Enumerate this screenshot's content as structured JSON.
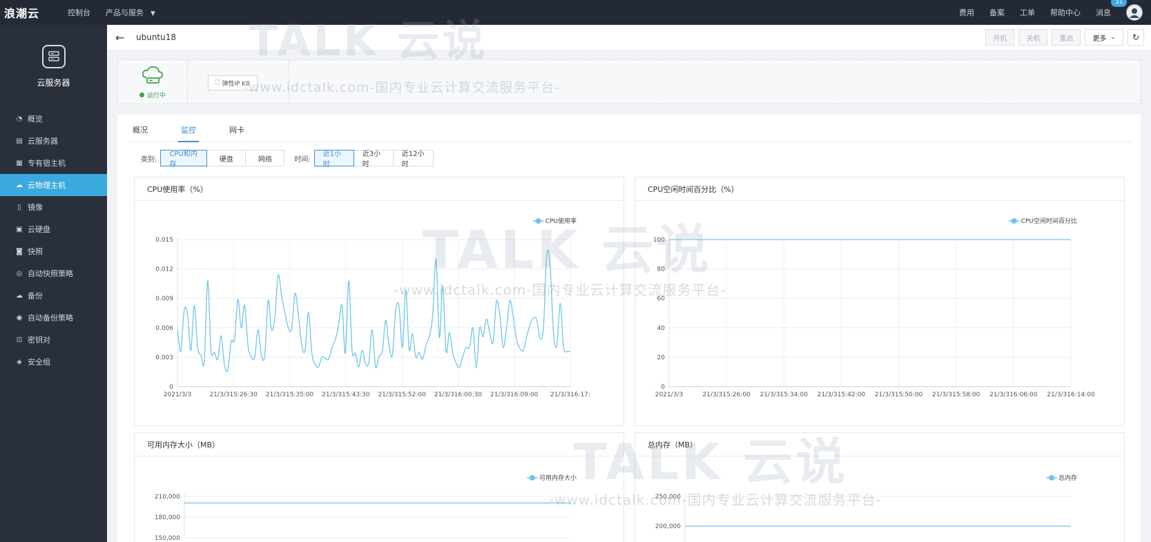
{
  "topbar": {
    "logo": "浪潮云",
    "nav": [
      "控制台",
      "产品与服务"
    ],
    "right": [
      "费用",
      "备案",
      "工单",
      "帮助中心",
      "消息"
    ],
    "message_count": "31"
  },
  "sidebar": {
    "title": "云服务器",
    "items": [
      {
        "label": "概览",
        "icon": "dashboard-icon"
      },
      {
        "label": "云服务器",
        "icon": "server-icon"
      },
      {
        "label": "专有宿主机",
        "icon": "host-icon"
      },
      {
        "label": "云物理主机",
        "icon": "cloud-icon",
        "active": true
      },
      {
        "label": "镜像",
        "icon": "image-icon"
      },
      {
        "label": "云硬盘",
        "icon": "disk-icon"
      },
      {
        "label": "快照",
        "icon": "camera-icon"
      },
      {
        "label": "自动快照策略",
        "icon": "policy-icon"
      },
      {
        "label": "备份",
        "icon": "backup-icon"
      },
      {
        "label": "自动备份策略",
        "icon": "backup-policy-icon"
      },
      {
        "label": "密钥对",
        "icon": "lock-icon"
      },
      {
        "label": "安全组",
        "icon": "shield-icon"
      }
    ]
  },
  "header": {
    "instance_name": "ubuntu18",
    "actions": [
      "开机",
      "关机",
      "重启",
      "更多"
    ]
  },
  "status": {
    "text": "运行中",
    "elastic_ip_button": "弹性IP K8"
  },
  "tabs": [
    "概况",
    "监控",
    "网卡"
  ],
  "active_tab": 1,
  "filters": {
    "category_label": "类别:",
    "categories": [
      "CPU和内存",
      "硬盘",
      "网络"
    ],
    "category_selected": 0,
    "time_label": "时间:",
    "times": [
      "近1小时",
      "近3小时",
      "近12小时"
    ],
    "time_selected": 0
  },
  "watermark": {
    "brand": "TALK 云说",
    "url": "-www.idctalk.com-国内专业云计算交流服务平台-"
  },
  "colors": {
    "accent": "#3aa9de",
    "line": "#6ec6e8",
    "running": "#41a14a"
  },
  "chart_data": [
    {
      "type": "line",
      "title": "CPU使用率（%）",
      "series": [
        {
          "name": "CPU使用率",
          "values": [
            0.0058,
            0.0036,
            0.0078,
            0.0074,
            0.0037,
            0.0083,
            0.004,
            0.0032,
            0.0026,
            0.0108,
            0.0037,
            0.0035,
            0.0028,
            0.0052,
            0.0022,
            0.0017,
            0.0046,
            0.0048,
            0.0089,
            0.006,
            0.0083,
            0.0042,
            0.003,
            0.003,
            0.0058,
            0.0032,
            0.0032,
            0.0088,
            0.0058,
            0.007,
            0.0114,
            0.0093,
            0.0075,
            0.006,
            0.0059,
            0.0095,
            0.0074,
            0.0043,
            0.0037,
            0.0076,
            0.0035,
            0.0023,
            0.002,
            0.003,
            0.0029,
            0.0028,
            0.004,
            0.0048,
            0.0063,
            0.0083,
            0.0034,
            0.0108,
            0.0037,
            0.0034,
            0.002,
            0.0037,
            0.0023,
            0.0025,
            0.0058,
            0.002,
            0.0031,
            0.0036,
            0.0068,
            0.0042,
            0.0032,
            0.0078,
            0.0082,
            0.004,
            0.0098,
            0.0038,
            0.0054,
            0.003,
            0.0035,
            0.0028,
            0.0042,
            0.0051,
            0.0072,
            0.013,
            0.005,
            0.0103,
            0.0036,
            0.0055,
            0.0034,
            0.0024,
            0.002,
            0.0031,
            0.004,
            0.004,
            0.006,
            0.0019,
            0.006,
            0.0051,
            0.0069,
            0.0055,
            0.0045,
            0.0087,
            0.0073,
            0.004,
            0.006,
            0.0088,
            0.0071,
            0.0048,
            0.0039,
            0.0037,
            0.0051,
            0.0063,
            0.007,
            0.0068,
            0.0049,
            0.0061,
            0.0135,
            0.0122,
            0.0054,
            0.0042,
            0.0085,
            0.004,
            0.0036,
            0.0036
          ]
        }
      ],
      "x_ticks": [
        "2021/3/3",
        "21/3/315:26:30",
        "21/3/315:35:00",
        "21/3/315:43:30",
        "21/3/315:52:00",
        "21/3/316:00:30",
        "21/3/316:09:00",
        "21/3/316:17:"
      ],
      "y_ticks": [
        "0.015",
        "0.012",
        "0.009",
        "0.006",
        "0.003",
        "0"
      ],
      "ylim": [
        0,
        0.015
      ],
      "legend": "top-right",
      "grid": true
    },
    {
      "type": "line",
      "title": "CPU空闲时间百分比（%）",
      "series": [
        {
          "name": "CPU空闲时间百分比",
          "values": [
            100,
            100
          ]
        }
      ],
      "x_ticks": [
        "2021/3/3",
        "21/3/315:26:00",
        "21/3/315:34:00",
        "21/3/315:42:00",
        "21/3/315:50:00",
        "21/3/315:58:00",
        "21/3/316:06:00",
        "21/3/316:14:00"
      ],
      "y_ticks": [
        "100",
        "80",
        "60",
        "40",
        "20",
        "0"
      ],
      "ylim": [
        0,
        100
      ],
      "legend": "top-right",
      "grid": true
    },
    {
      "type": "line",
      "title": "可用内存大小（MB）",
      "series": [
        {
          "name": "可用内存大小",
          "values": [
            200500,
            200500
          ]
        }
      ],
      "y_ticks": [
        "210,000",
        "180,000",
        "150,000"
      ],
      "ylim": [
        150000,
        210000
      ],
      "legend": "top-right",
      "grid": true
    },
    {
      "type": "line",
      "title": "总内存（MB）",
      "series": [
        {
          "name": "总内存",
          "values": [
            200000,
            200000
          ]
        }
      ],
      "y_ticks": [
        "250,000",
        "200,000"
      ],
      "ylim": [
        150000,
        250000
      ],
      "legend": "top-right",
      "grid": true
    }
  ]
}
